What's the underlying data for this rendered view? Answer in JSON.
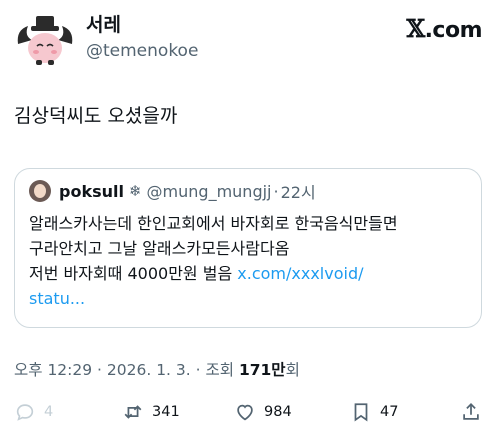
{
  "author": {
    "display_name": "서레",
    "handle": "@temenokoe"
  },
  "brand": {
    "x_glyph": "𝕏",
    "suffix": ".com"
  },
  "tweet": {
    "text": "김상덕씨도 오셨을까"
  },
  "quoted_tweet": {
    "name": "poksull",
    "badge_icon": "snowflake",
    "badge_glyph": "❄",
    "handle": "@mung_mungjj",
    "separator": "·",
    "time": "22시",
    "lines": [
      "알래스카사는데 한인교회에서 바자회로 한국음식만들면",
      "구라안치고 그날 알래스카모든사람다옴",
      "저번 바자회때 4000만원 벌음 "
    ],
    "link_part1": "x.com/xxxlvoid/",
    "link_part2": "statu..."
  },
  "meta": {
    "timestamp": "오후 12:29 · 2026. 1. 3. · 조회 ",
    "views": "171만",
    "views_suffix": "회"
  },
  "actions": {
    "reply_count": "4",
    "retweet_count": "341",
    "like_count": "984",
    "bookmark_count": "47"
  },
  "colors": {
    "text": "#0f1419",
    "secondary": "#536471",
    "link": "#1d9bf0",
    "border": "#cfd9de"
  }
}
